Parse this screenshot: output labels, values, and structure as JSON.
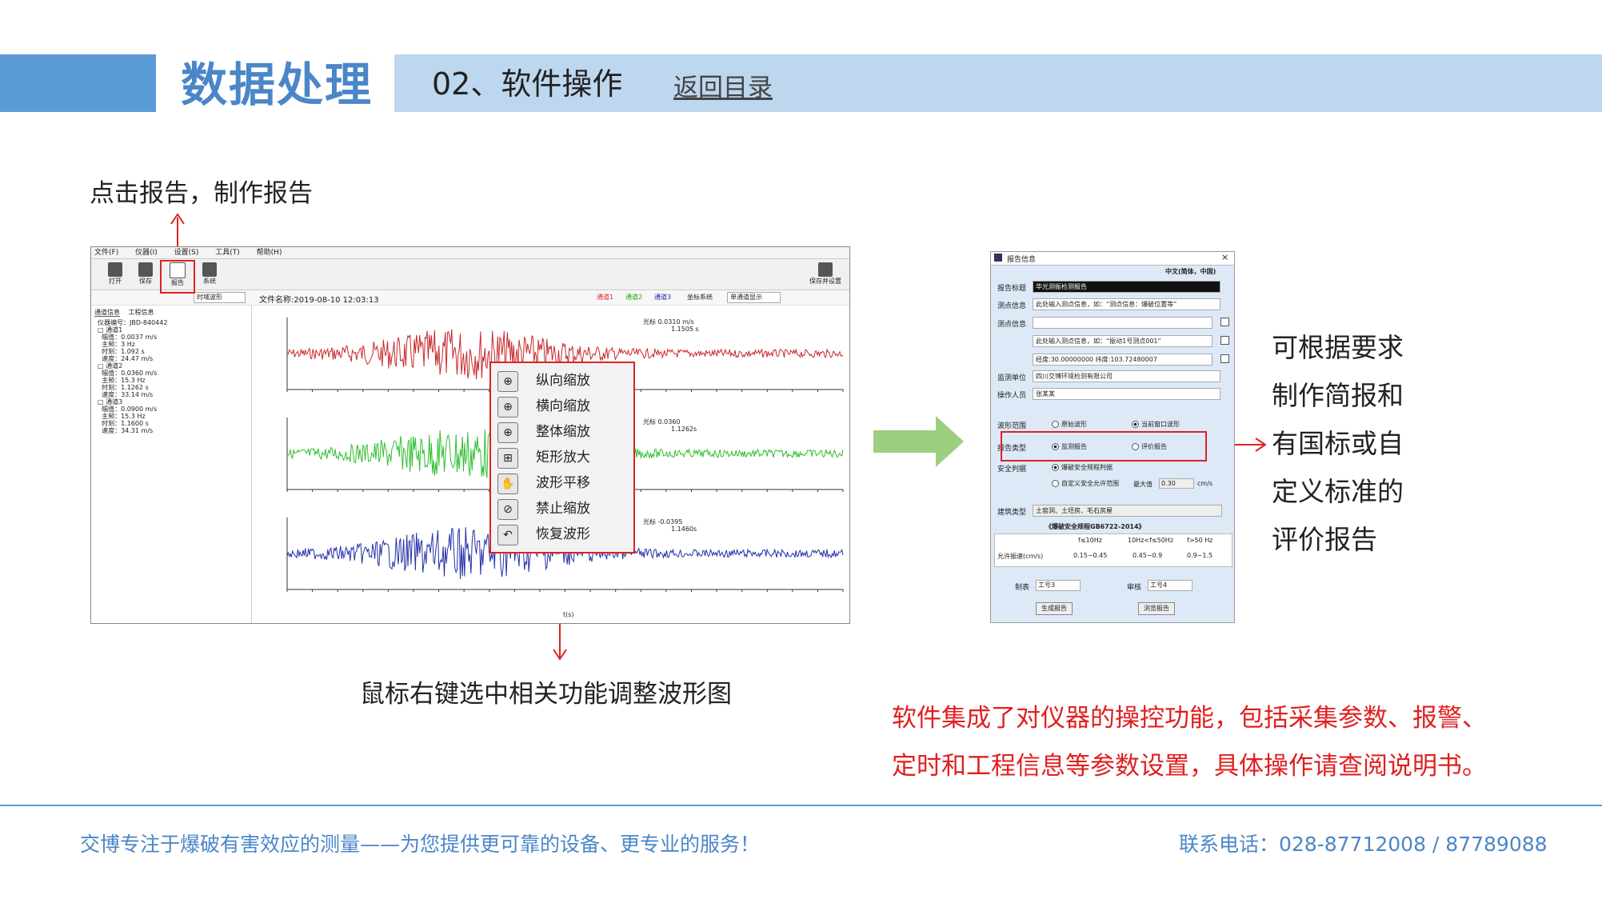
{
  "header": {
    "title": "数据处理",
    "subtitle": "02、软件操作",
    "back_link": "返回目录"
  },
  "callouts": {
    "click_report": "点击报告，制作报告",
    "right_click": "鼠标右键选中相关功能调整波形图",
    "side_lines": [
      "可根据要求",
      "制作简报和",
      "有国标或自",
      "定义标准的",
      "评价报告"
    ],
    "red_note_line1": "软件集成了对仪器的操控功能，包括采集参数、报警、",
    "red_note_line2": "定时和工程信息等参数设置，具体操作请查阅说明书。"
  },
  "footer": {
    "left": "交博专注于爆破有害效应的测量——为您提供更可靠的设备、更专业的服务！",
    "right": "联系电话：028-87712008 / 87789088"
  },
  "software": {
    "menu": [
      "文件(F)",
      "仪器(I)",
      "设置(S)",
      "工具(T)",
      "帮助(H)"
    ],
    "toolbar": [
      {
        "label": "打开",
        "icon": "folder-open-icon"
      },
      {
        "label": "保存",
        "icon": "save-icon"
      },
      {
        "label": "报告",
        "icon": "report-icon"
      },
      {
        "label": "系统",
        "icon": "system-icon"
      }
    ],
    "toolbar_right": "保存并设置",
    "view_select": "时域波形",
    "file_name": "文件名称:2019-08-10 12:03:13",
    "channels": [
      "通道1",
      "通道2",
      "通道3"
    ],
    "display_label": "坐标系统",
    "display_select": "单通道显示",
    "left_tabs": [
      "通道信息",
      "工程信息"
    ],
    "left_tree": [
      "仪器编号：JBD-840442",
      "□ 通道1",
      "  幅值：0.0037 m/s",
      "  主频：3 Hz",
      "  时刻：1.092 s",
      "  速度：24.47 m/s",
      "□ 通道2",
      "  幅值：0.0360 m/s",
      "  主频：15.3 Hz",
      "  时刻：1.1262 s",
      "  速度：33.14 m/s",
      "□ 通道3",
      "  幅值：0.0900 m/s",
      "  主频：15.3 Hz",
      "  时刻：1.1600 s",
      "  速度：34.31 m/s"
    ],
    "plot_labels": [
      {
        "peak": "光标  0.0310 m/s",
        "time": "1.1505 s"
      },
      {
        "peak": "光标  0.0360",
        "time": "1.1262s"
      },
      {
        "peak": "光标  -0.0395",
        "time": "1.1460s"
      }
    ],
    "x_axis_label": "t(s)",
    "context_menu": [
      {
        "label": "纵向缩放",
        "icon": "zoom-vertical-icon"
      },
      {
        "label": "横向缩放",
        "icon": "zoom-horizontal-icon"
      },
      {
        "label": "整体缩放",
        "icon": "zoom-all-icon"
      },
      {
        "label": "矩形放大",
        "icon": "zoom-rect-icon"
      },
      {
        "label": "波形平移",
        "icon": "hand-pan-icon"
      },
      {
        "label": "禁止缩放",
        "icon": "zoom-disable-icon"
      },
      {
        "label": "恢复波形",
        "icon": "undo-icon"
      }
    ]
  },
  "dialog": {
    "title": "报告信息",
    "lang": "中文(简体，中国)",
    "fields": [
      {
        "label": "报告标题",
        "value": "华光测振检测报告"
      },
      {
        "label": "测点信息",
        "value": "此处输入测点信息，如：“测点信息：爆破位置等”"
      },
      {
        "label": "测点信息",
        "value": ""
      },
      {
        "label": "",
        "value": "此处输入测点信息，如：“振动1号测点001”"
      },
      {
        "label": "",
        "value": "经度:30.00000000  纬度:103.72480007"
      },
      {
        "label": "监测单位",
        "value": "四川交博环境检测有限公司"
      },
      {
        "label": "操作人员",
        "value": "张某某"
      }
    ],
    "wave_range_label": "波形范围",
    "wave_range_opts": [
      "原始波形",
      "当前窗口波形"
    ],
    "report_type_label": "报告类型",
    "report_type_opts": [
      "监测报告",
      "评价报告"
    ],
    "safety_label": "安全判据",
    "safety_opts": [
      "爆破安全规程判据",
      "自定义安全允许范围"
    ],
    "max_label": "最大值",
    "max_value": "0.30",
    "max_unit": "cm/s",
    "building_label": "建筑类型",
    "building_value": "土窑洞、土坯房、毛石房屋",
    "standard": "《爆破安全规程GB6722-2014》",
    "table_headers": [
      "f≤10Hz",
      "10Hz<f≤50Hz",
      "f>50 Hz"
    ],
    "table_row_label": "允许振速(cm/s)",
    "table_row": [
      "0.15~0.45",
      "0.45~0.9",
      "0.9~1.5"
    ],
    "audit_label": "制表",
    "audit_value": "工号3",
    "review_label": "审核",
    "review_value": "工号4",
    "btn_generate": "生成报告",
    "btn_preview": "浏览报告"
  }
}
